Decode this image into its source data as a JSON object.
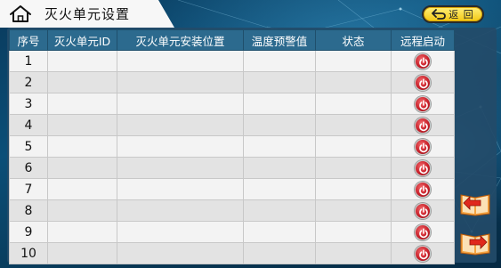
{
  "header": {
    "title": "灭火单元设置",
    "home_icon": "home-icon"
  },
  "toolbar": {
    "back_label": "返 回",
    "back_icon": "return-arrow-icon"
  },
  "table": {
    "columns": [
      "序号",
      "灭火单元ID",
      "灭火单元安装位置",
      "温度预警值",
      "状态",
      "远程启动"
    ],
    "rows": [
      {
        "index": "1",
        "unit_id": "",
        "location": "",
        "temp_warning": "",
        "status": ""
      },
      {
        "index": "2",
        "unit_id": "",
        "location": "",
        "temp_warning": "",
        "status": ""
      },
      {
        "index": "3",
        "unit_id": "",
        "location": "",
        "temp_warning": "",
        "status": ""
      },
      {
        "index": "4",
        "unit_id": "",
        "location": "",
        "temp_warning": "",
        "status": ""
      },
      {
        "index": "5",
        "unit_id": "",
        "location": "",
        "temp_warning": "",
        "status": ""
      },
      {
        "index": "6",
        "unit_id": "",
        "location": "",
        "temp_warning": "",
        "status": ""
      },
      {
        "index": "7",
        "unit_id": "",
        "location": "",
        "temp_warning": "",
        "status": ""
      },
      {
        "index": "8",
        "unit_id": "",
        "location": "",
        "temp_warning": "",
        "status": ""
      },
      {
        "index": "9",
        "unit_id": "",
        "location": "",
        "temp_warning": "",
        "status": ""
      },
      {
        "index": "10",
        "unit_id": "",
        "location": "",
        "temp_warning": "",
        "status": ""
      }
    ],
    "start_icon": "power-icon"
  },
  "pager": {
    "prev_icon": "book-prev-page-icon",
    "next_icon": "book-next-page-icon"
  },
  "colors": {
    "header_bg": "#f7f7f7",
    "table_header_bg": "#2c6a8e",
    "back_button": "#f2c712",
    "power_button": "#c8202a",
    "page_button": "#f07a1a"
  }
}
